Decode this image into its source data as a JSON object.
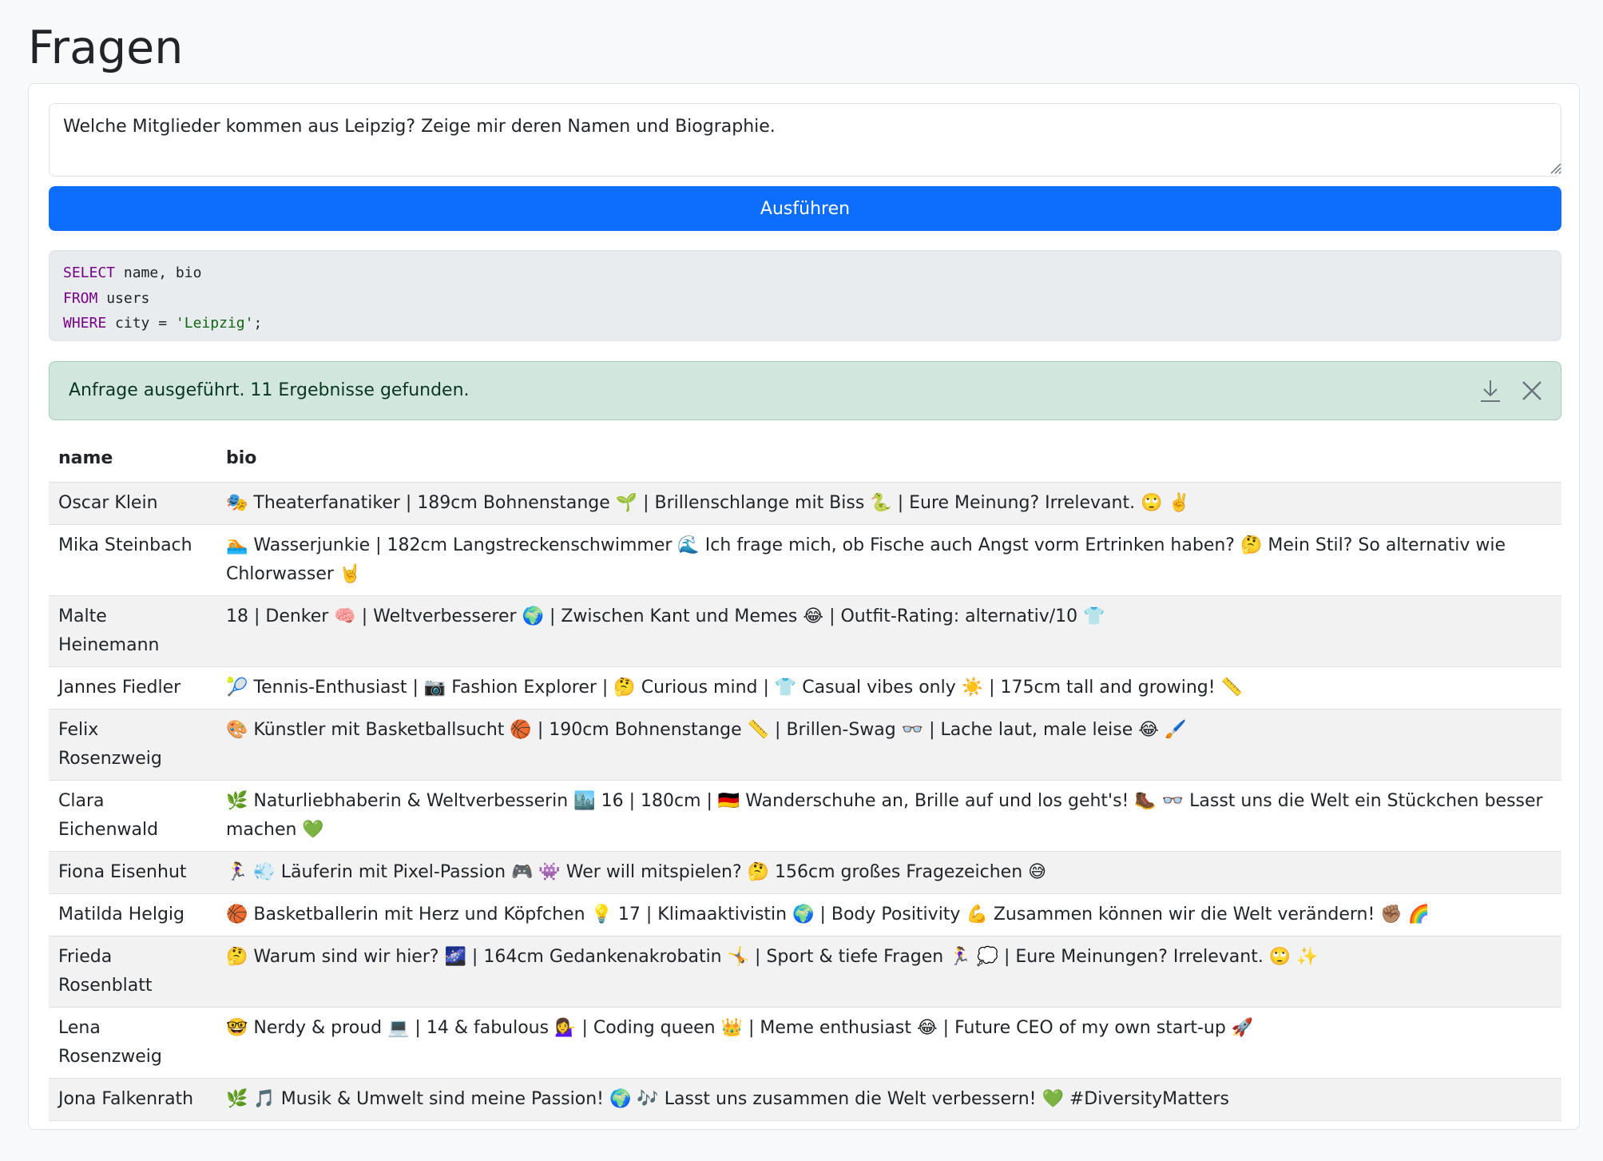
{
  "page": {
    "title": "Fragen"
  },
  "query_form": {
    "question": "Welche Mitglieder kommen aus Leipzig? Zeige mir deren Namen und Biographie.",
    "run_label": "Ausführen"
  },
  "sql": {
    "line1_kw": "SELECT",
    "line1_rest": " name, bio",
    "line2_kw": "FROM",
    "line2_rest": " users",
    "line3_kw": "WHERE",
    "line3_rest": " city = ",
    "line3_str": "'Leipzig'",
    "line3_end": ";"
  },
  "alert": {
    "message": "Anfrage ausgeführt. 11 Ergebnisse gefunden.",
    "download_icon": "download-icon",
    "close_icon": "close-icon"
  },
  "colors": {
    "primary": "#0d6efd",
    "success_bg": "#d1e7dd",
    "success_text": "#0a3622",
    "sql_keyword": "#770088",
    "sql_string": "#116611"
  },
  "results": {
    "columns": [
      "name",
      "bio"
    ],
    "rows": [
      [
        "Oscar Klein",
        "🎭 Theaterfanatiker | 189cm Bohnenstange 🌱 | Brillenschlange mit Biss 🐍 | Eure Meinung? Irrelevant. 🙄 ✌️"
      ],
      [
        "Mika Steinbach",
        "🏊 Wasserjunkie | 182cm Langstreckenschwimmer 🌊 Ich frage mich, ob Fische auch Angst vorm Ertrinken haben? 🤔 Mein Stil? So alternativ wie Chlorwasser 🤘"
      ],
      [
        "Malte Heinemann",
        "18 | Denker 🧠 | Weltverbesserer 🌍 | Zwischen Kant und Memes 😂 | Outfit-Rating: alternativ/10 👕"
      ],
      [
        "Jannes Fiedler",
        "🎾 Tennis-Enthusiast | 📷 Fashion Explorer | 🤔 Curious mind | 👕 Casual vibes only ☀️ | 175cm tall and growing! 📏"
      ],
      [
        "Felix Rosenzweig",
        "🎨 Künstler mit Basketballsucht 🏀 | 190cm Bohnenstange 📏 | Brillen-Swag 👓 | Lache laut, male leise 😂 🖌️"
      ],
      [
        "Clara Eichenwald",
        "🌿 Naturliebhaberin & Weltverbesserin 🏙️ 16 | 180cm | 🇩🇪 Wanderschuhe an, Brille auf und los geht's! 🥾 👓 Lasst uns die Welt ein Stückchen besser machen 💚"
      ],
      [
        "Fiona Eisenhut",
        "🏃‍♀️ 💨 Läuferin mit Pixel-Passion 🎮 👾 Wer will mitspielen? 🤔 156cm großes Fragezeichen 😅"
      ],
      [
        "Matilda Helgig",
        "🏀 Basketballerin mit Herz und Köpfchen 💡 17 | Klimaaktivistin 🌍 | Body Positivity 💪 Zusammen können wir die Welt verändern! ✊🏽 🌈"
      ],
      [
        "Frieda Rosenblatt",
        "🤔 Warum sind wir hier? 🌌 | 164cm Gedankenakrobatin 🤸 | Sport & tiefe Fragen 🏃‍♀️ 💭 | Eure Meinungen? Irrelevant. 🙄 ✨"
      ],
      [
        "Lena Rosenzweig",
        "🤓 Nerdy & proud 💻 | 14 & fabulous 💁‍♀️ | Coding queen 👑 | Meme enthusiast 😂 | Future CEO of my own start-up 🚀"
      ],
      [
        "Jona Falkenrath",
        "🌿 🎵 Musik & Umwelt sind meine Passion! 🌍 🎶 Lasst uns zusammen die Welt verbessern! 💚 #DiversityMatters"
      ]
    ]
  }
}
